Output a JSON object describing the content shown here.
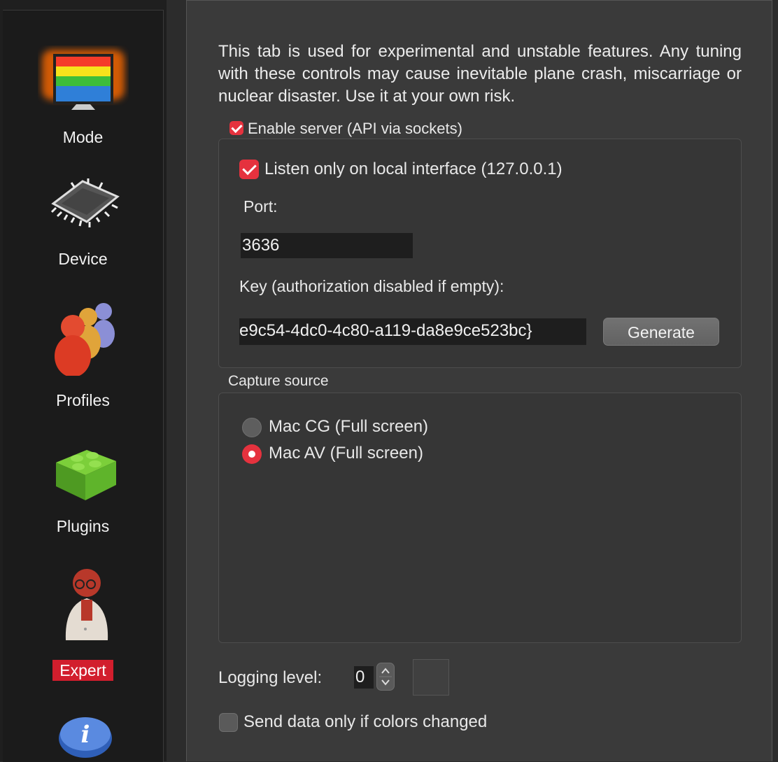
{
  "sidebar": {
    "items": [
      {
        "label": "Mode",
        "icon": "monitor-rainbow-icon"
      },
      {
        "label": "Device",
        "icon": "chip-icon"
      },
      {
        "label": "Profiles",
        "icon": "people-icon"
      },
      {
        "label": "Plugins",
        "icon": "lego-brick-icon"
      },
      {
        "label": "Expert",
        "icon": "scientist-icon",
        "active": true
      },
      {
        "label": "",
        "icon": "info-icon"
      }
    ],
    "active_color": "#d21e2d"
  },
  "expert": {
    "warning_text": "This tab is used for experimental and unstable features. Any tuning with these controls may cause inevitable plane crash, miscarriage or nuclear disaster. Use it at your own risk.",
    "server": {
      "enable_label": "Enable server (API via sockets)",
      "enable_checked": true,
      "local_only_label": "Listen only on local interface (127.0.0.1)",
      "local_only_checked": true,
      "port_label": "Port:",
      "port_value": "3636",
      "key_label": "Key (authorization disabled if empty):",
      "key_value": "e9c54-4dc0-4c80-a119-da8e9ce523bc}",
      "generate_label": "Generate"
    },
    "capture": {
      "title": "Capture source",
      "options": [
        {
          "label": "Mac CG (Full screen)",
          "selected": false
        },
        {
          "label": "Mac AV (Full screen)",
          "selected": true
        }
      ]
    },
    "logging_label": "Logging level:",
    "logging_value": "0",
    "send_changed_label": "Send data only if colors changed",
    "send_changed_checked": false
  },
  "accent_color": "#e5323e"
}
